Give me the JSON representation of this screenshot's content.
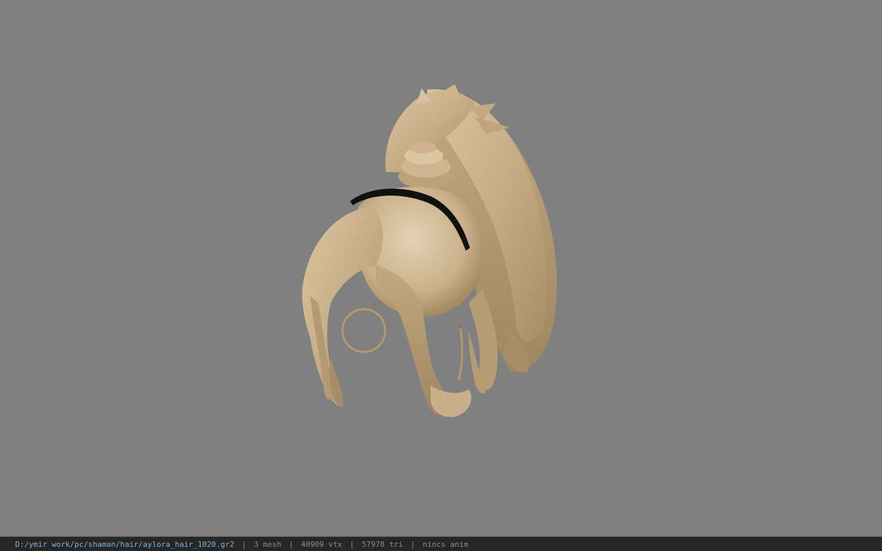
{
  "viewer": {
    "background_color": "#808080",
    "model_name": "aylora_hair_1020",
    "hair_color": "#c9b08a",
    "band_color": "#111111",
    "earring_color": "#b39a6a"
  },
  "status": {
    "path": "D:/ymir work/pc/shaman/hair/aylora_hair_1020.gr2",
    "sep": "|",
    "mesh": "3 mesh",
    "vtx": "40909 vtx",
    "tri": "57978 tri",
    "anim": "nincs anim"
  }
}
